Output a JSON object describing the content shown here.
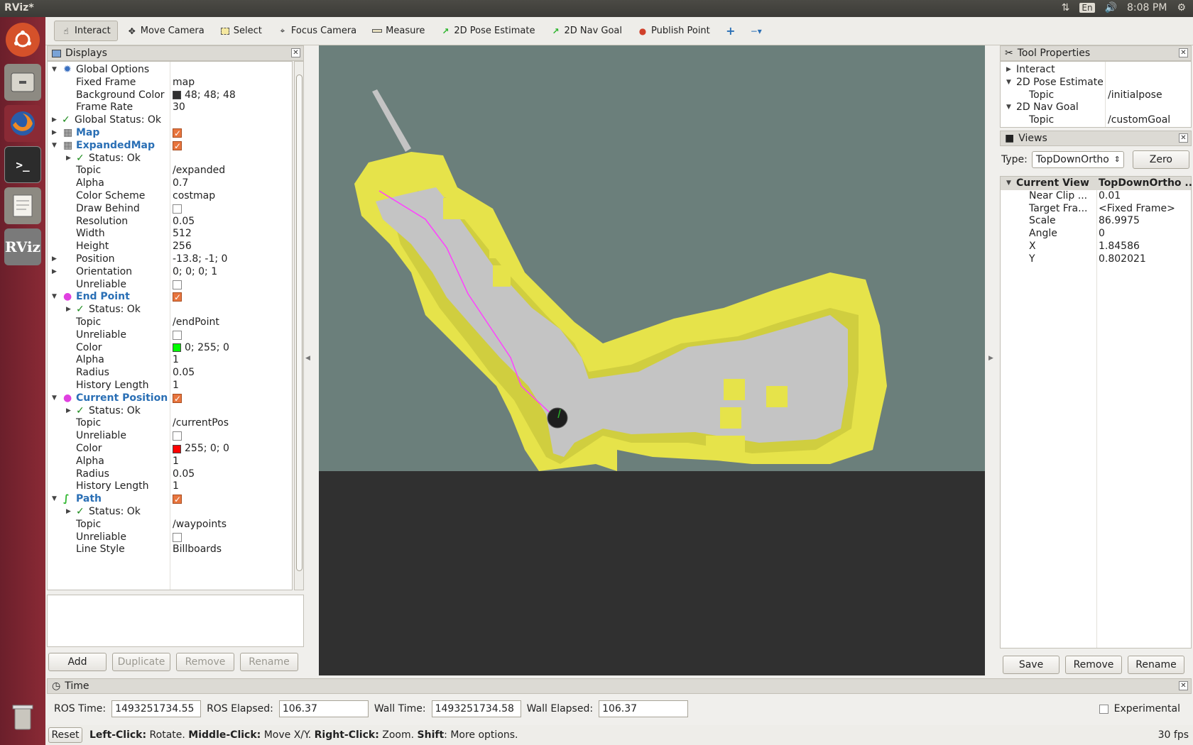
{
  "window": {
    "title": "RViz*"
  },
  "tray": {
    "lang": "En",
    "time": "8:08 PM"
  },
  "launcher": [
    "ubuntu-icon",
    "files-icon",
    "firefox-icon",
    "terminal-icon",
    "text-editor-icon",
    "rviz-icon",
    "trash-icon"
  ],
  "launcher_rviz_label": "RViz",
  "toolbar": {
    "interact": "Interact",
    "move_camera": "Move Camera",
    "select": "Select",
    "focus_camera": "Focus Camera",
    "measure": "Measure",
    "pose_estimate": "2D Pose Estimate",
    "nav_goal": "2D Nav Goal",
    "publish_point": "Publish Point"
  },
  "displays": {
    "title": "Displays",
    "rows": [
      {
        "k": "Global Options",
        "v": ""
      },
      {
        "k": "Fixed Frame",
        "v": "map"
      },
      {
        "k": "Background Color",
        "v": "48; 48; 48"
      },
      {
        "k": "Frame Rate",
        "v": "30"
      },
      {
        "k": "Global Status: Ok",
        "v": ""
      },
      {
        "k": "Map",
        "v": ""
      },
      {
        "k": "ExpandedMap",
        "v": ""
      },
      {
        "k": "Status: Ok",
        "v": ""
      },
      {
        "k": "Topic",
        "v": "/expanded"
      },
      {
        "k": "Alpha",
        "v": "0.7"
      },
      {
        "k": "Color Scheme",
        "v": "costmap"
      },
      {
        "k": "Draw Behind",
        "v": ""
      },
      {
        "k": "Resolution",
        "v": "0.05"
      },
      {
        "k": "Width",
        "v": "512"
      },
      {
        "k": "Height",
        "v": "256"
      },
      {
        "k": "Position",
        "v": "-13.8; -1; 0"
      },
      {
        "k": "Orientation",
        "v": "0; 0; 0; 1"
      },
      {
        "k": "Unreliable",
        "v": ""
      },
      {
        "k": "End Point",
        "v": ""
      },
      {
        "k": "Status: Ok",
        "v": ""
      },
      {
        "k": "Topic",
        "v": "/endPoint"
      },
      {
        "k": "Unreliable",
        "v": ""
      },
      {
        "k": "Color",
        "v": "0; 255; 0"
      },
      {
        "k": "Alpha",
        "v": "1"
      },
      {
        "k": "Radius",
        "v": "0.05"
      },
      {
        "k": "History Length",
        "v": "1"
      },
      {
        "k": "Current Position",
        "v": ""
      },
      {
        "k": "Status: Ok",
        "v": ""
      },
      {
        "k": "Topic",
        "v": "/currentPos"
      },
      {
        "k": "Unreliable",
        "v": ""
      },
      {
        "k": "Color",
        "v": "255; 0; 0"
      },
      {
        "k": "Alpha",
        "v": "1"
      },
      {
        "k": "Radius",
        "v": "0.05"
      },
      {
        "k": "History Length",
        "v": "1"
      },
      {
        "k": "Path",
        "v": ""
      },
      {
        "k": "Status: Ok",
        "v": ""
      },
      {
        "k": "Topic",
        "v": "/waypoints"
      },
      {
        "k": "Unreliable",
        "v": ""
      },
      {
        "k": "Line Style",
        "v": "Billboards"
      }
    ],
    "buttons": {
      "add": "Add",
      "duplicate": "Duplicate",
      "remove": "Remove",
      "rename": "Rename"
    }
  },
  "colors": {
    "background_swatch": "#303030",
    "end_point_swatch": "#00ff00",
    "current_position_swatch": "#ff0000",
    "accent_orange": "#e8753e",
    "costmap_yellow": "#e6e34a",
    "map_free": "#c4c4c4",
    "map_unknown": "#6b7f7b",
    "path_magenta": "#ff40ff"
  },
  "tool_properties": {
    "title": "Tool Properties",
    "rows": [
      {
        "k": "Interact",
        "v": ""
      },
      {
        "k": "2D Pose Estimate",
        "v": ""
      },
      {
        "k": "Topic",
        "v": "/initialpose"
      },
      {
        "k": "2D Nav Goal",
        "v": ""
      },
      {
        "k": "Topic",
        "v": "/customGoal"
      }
    ]
  },
  "views": {
    "title": "Views",
    "type_label": "Type:",
    "type_value": "TopDownOrtho",
    "zero": "Zero",
    "rows": [
      {
        "k": "Current View",
        "v": "TopDownOrtho ..."
      },
      {
        "k": "Near Clip ...",
        "v": "0.01"
      },
      {
        "k": "Target Fra...",
        "v": "<Fixed Frame>"
      },
      {
        "k": "Scale",
        "v": "86.9975"
      },
      {
        "k": "Angle",
        "v": "0"
      },
      {
        "k": "X",
        "v": "1.84586"
      },
      {
        "k": "Y",
        "v": "0.802021"
      }
    ],
    "buttons": {
      "save": "Save",
      "remove": "Remove",
      "rename": "Rename"
    }
  },
  "time": {
    "title": "Time",
    "ros_time_label": "ROS Time:",
    "ros_time": "1493251734.55",
    "ros_elapsed_label": "ROS Elapsed:",
    "ros_elapsed": "106.37",
    "wall_time_label": "Wall Time:",
    "wall_time": "1493251734.58",
    "wall_elapsed_label": "Wall Elapsed:",
    "wall_elapsed": "106.37",
    "experimental": "Experimental"
  },
  "status": {
    "reset": "Reset",
    "left_click": "Left-Click:",
    "left_click_action": "Rotate.",
    "middle_click": "Middle-Click:",
    "middle_click_action": "Move X/Y.",
    "right_click": "Right-Click:",
    "right_click_action": "Zoom.",
    "shift": "Shift",
    "shift_action": "More options.",
    "fps": "30 fps"
  }
}
